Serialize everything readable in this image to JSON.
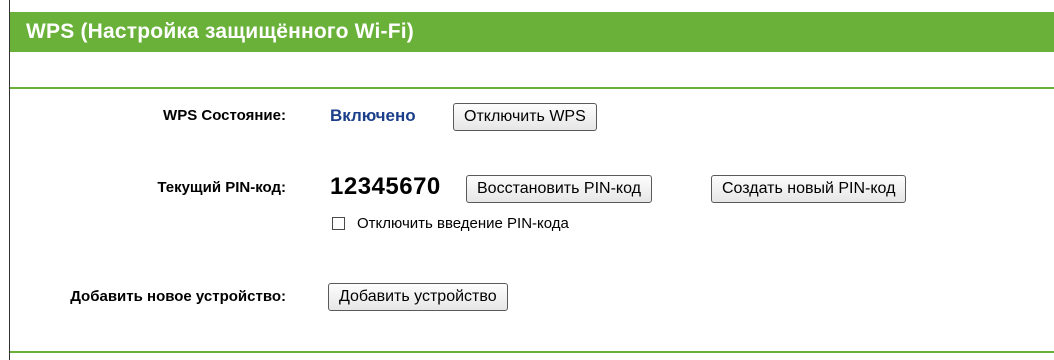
{
  "header": {
    "title": "WPS (Настройка защищённого Wi-Fi)"
  },
  "wps_status": {
    "label": "WPS Состояние:",
    "value": "Включено",
    "toggle_button": "Отключить WPS"
  },
  "pin": {
    "label": "Текущий PIN-код:",
    "value": "12345670",
    "restore_button": "Восстановить PIN-код",
    "generate_button": "Создать новый PIN-код",
    "disable_checkbox_label": "Отключить введение PIN-кода",
    "disable_checkbox_checked": false
  },
  "add_device": {
    "label": "Добавить новое устройство:",
    "button": "Добавить устройство"
  },
  "colors": {
    "accent_green": "#6ab13a",
    "status_blue": "#1b3f8b"
  }
}
